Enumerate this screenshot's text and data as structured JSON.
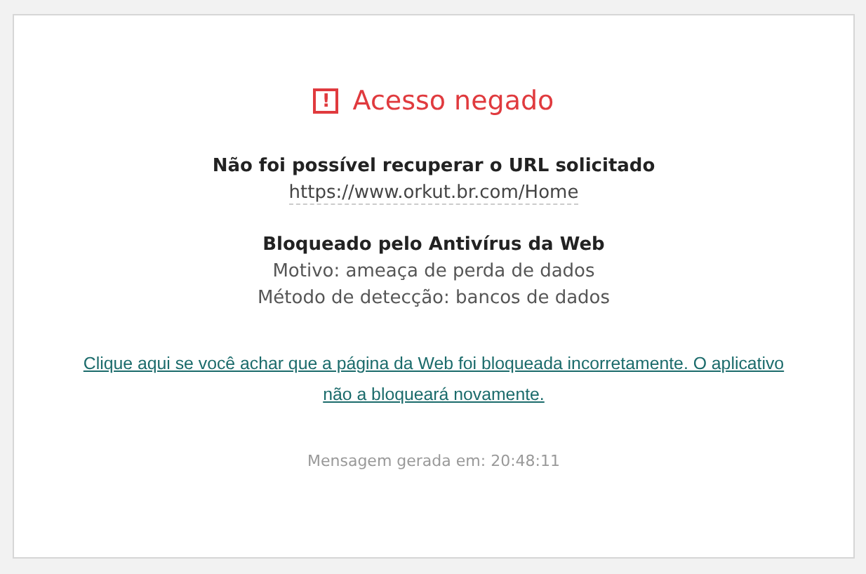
{
  "title": "Acesso negado",
  "icon": "!",
  "url_heading": "Não foi possível recuperar o URL solicitado",
  "url": "https://www.orkut.br.com/Home",
  "block_heading": "Bloqueado pelo Antivírus da Web",
  "details": [
    "Motivo: ameaça de perda de dados",
    "Método de detecção: bancos de dados"
  ],
  "link": "Clique aqui se você achar que a página da Web foi bloqueada incorretamente. O aplicativo não a bloqueará novamente.",
  "footer": "Mensagem gerada em: 20:48:11"
}
